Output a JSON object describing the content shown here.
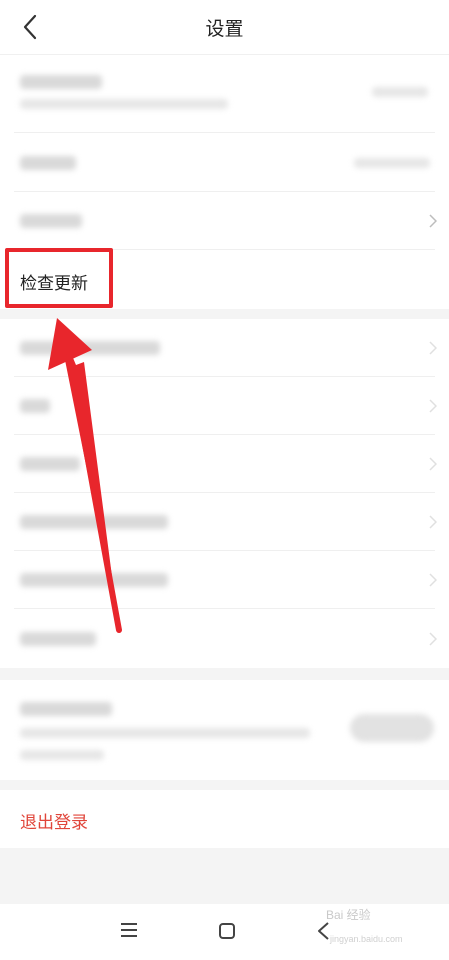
{
  "header": {
    "title": "设置",
    "back_icon": "chevron-left-icon"
  },
  "list": {
    "check_update_label": "检查更新"
  },
  "logout_label": "退出登录",
  "colors": {
    "accent_red": "#e8262c",
    "logout_red": "#e0453a"
  },
  "navbar": {
    "icons": [
      "menu-icon",
      "home-square-icon",
      "back-triangle-icon"
    ]
  },
  "watermark": {
    "brand": "Bai 经验",
    "url": "jingyan.baidu.com"
  }
}
